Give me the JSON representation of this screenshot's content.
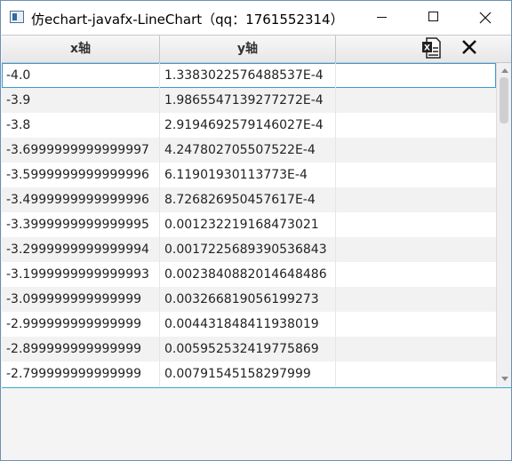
{
  "window": {
    "title": "仿echart-javafx-LineChart（qq：1761552314）",
    "icon": "app-window-icon",
    "controls": [
      "minimize-icon",
      "maximize-icon",
      "close-icon"
    ]
  },
  "table": {
    "columns": [
      "x轴",
      "y轴",
      ""
    ],
    "toolbar_icons": [
      "excel-export-icon",
      "close-icon"
    ],
    "selected_row": 0,
    "rows": [
      {
        "x": "-4.0",
        "y": "1.3383022576488537E-4"
      },
      {
        "x": "-3.9",
        "y": "1.9865547139277272E-4"
      },
      {
        "x": "-3.8",
        "y": "2.9194692579146027E-4"
      },
      {
        "x": "-3.6999999999999997",
        "y": "4.247802705507522E-4"
      },
      {
        "x": "-3.5999999999999996",
        "y": "6.11901930113773E-4"
      },
      {
        "x": "-3.4999999999999996",
        "y": "8.726826950457617E-4"
      },
      {
        "x": "-3.3999999999999995",
        "y": "0.001232219168473021"
      },
      {
        "x": "-3.2999999999999994",
        "y": "0.0017225689390536843"
      },
      {
        "x": "-3.1999999999999993",
        "y": "0.0023840882014648486"
      },
      {
        "x": "-3.099999999999999",
        "y": "0.003266819056199273"
      },
      {
        "x": "-2.999999999999999",
        "y": "0.004431848411938019"
      },
      {
        "x": "-2.899999999999999",
        "y": "0.005952532419775869"
      },
      {
        "x": "-2.799999999999999",
        "y": "0.00791545158297999"
      }
    ]
  }
}
